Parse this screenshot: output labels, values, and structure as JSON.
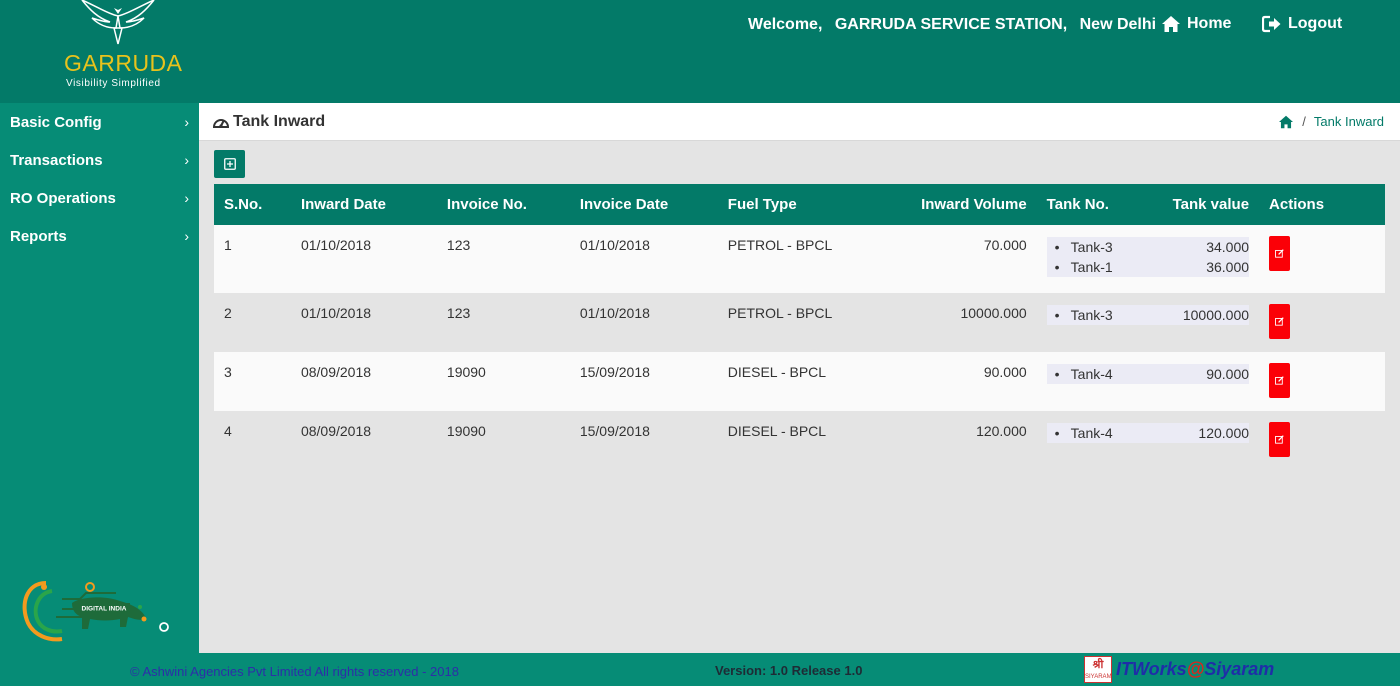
{
  "brand": {
    "name": "GARRUDA",
    "tagline": "Visibility Simplified"
  },
  "header": {
    "welcome": "Welcome,",
    "station": "GARRUDA SERVICE STATION,",
    "city": "New Delhi",
    "home_label": "Home",
    "logout_label": "Logout"
  },
  "sidebar": {
    "items": [
      {
        "label": "Basic Config"
      },
      {
        "label": "Transactions"
      },
      {
        "label": "RO Operations"
      },
      {
        "label": "Reports"
      }
    ],
    "badge_text": "DIGITAL INDIA"
  },
  "page": {
    "title": "Tank Inward",
    "breadcrumb": "Tank Inward"
  },
  "table": {
    "headers": {
      "sno": "S.No.",
      "inward_date": "Inward Date",
      "invoice_no": "Invoice No.",
      "invoice_date": "Invoice Date",
      "fuel_type": "Fuel Type",
      "inward_volume": "Inward Volume",
      "tank_no": "Tank No.",
      "tank_value": "Tank value",
      "actions": "Actions"
    },
    "rows": [
      {
        "sno": "1",
        "inward_date": "01/10/2018",
        "invoice_no": "123",
        "invoice_date": "01/10/2018",
        "fuel_type": "PETROL - BPCL",
        "inward_volume": "70.000",
        "tanks": [
          {
            "no": "Tank-3",
            "value": "34.000"
          },
          {
            "no": "Tank-1",
            "value": "36.000"
          }
        ]
      },
      {
        "sno": "2",
        "inward_date": "01/10/2018",
        "invoice_no": "123",
        "invoice_date": "01/10/2018",
        "fuel_type": "PETROL - BPCL",
        "inward_volume": "10000.000",
        "tanks": [
          {
            "no": "Tank-3",
            "value": "10000.000"
          }
        ]
      },
      {
        "sno": "3",
        "inward_date": "08/09/2018",
        "invoice_no": "19090",
        "invoice_date": "15/09/2018",
        "fuel_type": "DIESEL - BPCL",
        "inward_volume": "90.000",
        "tanks": [
          {
            "no": "Tank-4",
            "value": "90.000"
          }
        ]
      },
      {
        "sno": "4",
        "inward_date": "08/09/2018",
        "invoice_no": "19090",
        "invoice_date": "15/09/2018",
        "fuel_type": "DIESEL - BPCL",
        "inward_volume": "120.000",
        "tanks": [
          {
            "no": "Tank-4",
            "value": "120.000"
          }
        ]
      }
    ]
  },
  "footer": {
    "copyright": "© Ashwini Agencies Pvt Limited All rights reserved - 2018",
    "version": "Version: 1.0 Release 1.0",
    "brand_badge": "SIYARAM",
    "brand_prefix": "ITWorks",
    "brand_at": "@",
    "brand_suffix": "Siyaram"
  },
  "colors": {
    "header_bg": "#037a68",
    "sidebar_bg": "#068c76",
    "edit_button": "#fb0007",
    "logo_gold": "#e8c21c"
  },
  "icons": {
    "page_title": "dashboard-icon",
    "breadcrumb_home": "home-icon",
    "add": "plus-square-icon",
    "edit": "edit-icon",
    "logout": "logout-icon"
  }
}
